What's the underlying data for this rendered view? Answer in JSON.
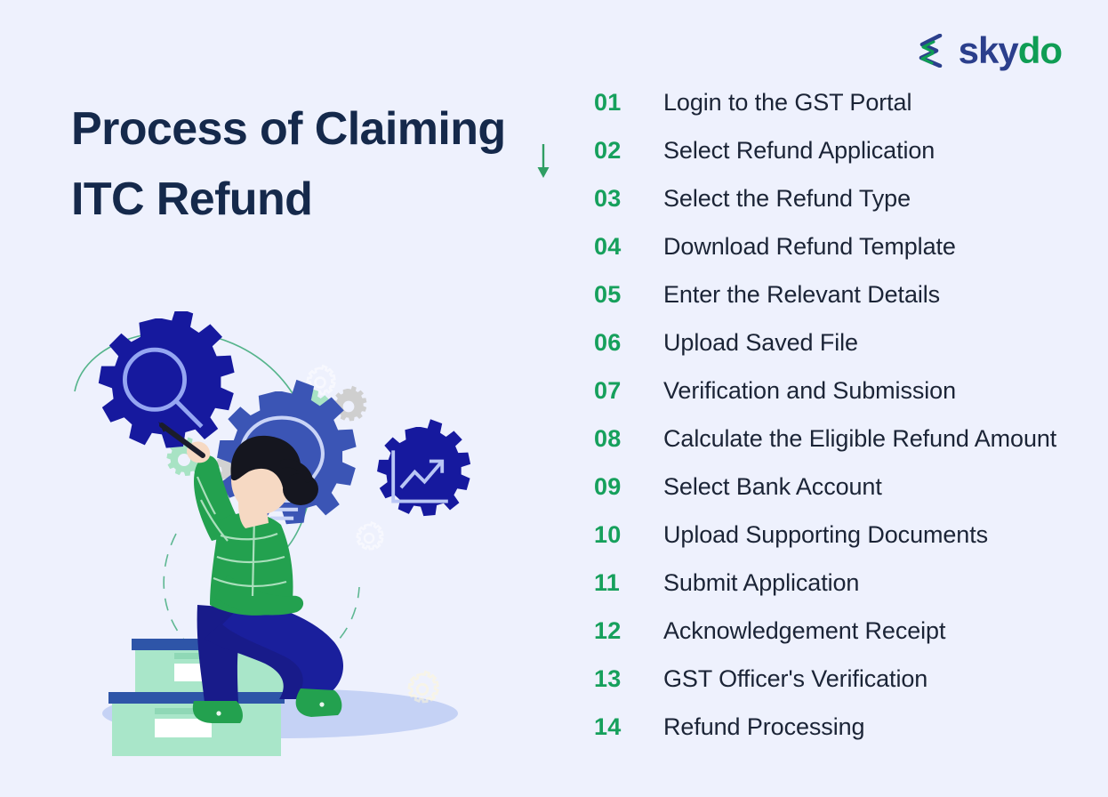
{
  "brand": {
    "logo_icon": "skydo-chevron-s-logo",
    "name_part1": "sky",
    "name_part2": "do",
    "color_blue": "#2b3f8c",
    "color_green": "#0f9d54"
  },
  "header": {
    "title_line1": "Process of Claiming",
    "title_line2": "ITC Refund",
    "title_color": "#15294b",
    "arrow_icon": "arrow-down-icon",
    "arrow_color": "#2f9e63"
  },
  "theme": {
    "background": "#eef1fd",
    "number_green": "#16a05c",
    "label_navy": "#1b2436",
    "gear_dark_navy": "#16199e",
    "gear_royal_blue": "#3b55b5",
    "gear_mint": "#a8e3c4",
    "gear_gray": "#d2d2d2",
    "sweater_green": "#23a14f",
    "pants_navy": "#181b8a",
    "box_mint": "#a9e6c9",
    "box_lid_blue": "#2e55a8",
    "shadow_blue": "#c5d2f5",
    "hair_black": "#15161f",
    "skin": "#f6d9c3"
  },
  "illustration": {
    "name": "person-with-gears-illustration",
    "gear_icons": [
      "magnifier-gear-icon",
      "lightbulb-gear-icon",
      "chart-gear-icon"
    ],
    "props": [
      "pen",
      "stacked-boxes",
      "floor-shadow"
    ]
  },
  "steps": [
    {
      "num": "01",
      "label": "Login to the GST Portal"
    },
    {
      "num": "02",
      "label": "Select Refund Application"
    },
    {
      "num": "03",
      "label": "Select the Refund Type"
    },
    {
      "num": "04",
      "label": "Download Refund Template"
    },
    {
      "num": "05",
      "label": "Enter the Relevant Details"
    },
    {
      "num": "06",
      "label": "Upload Saved File"
    },
    {
      "num": "07",
      "label": "Verification and Submission"
    },
    {
      "num": "08",
      "label": "Calculate the Eligible Refund Amount"
    },
    {
      "num": "09",
      "label": "Select Bank Account"
    },
    {
      "num": "10",
      "label": "Upload Supporting Documents"
    },
    {
      "num": "11",
      "label": "Submit Application"
    },
    {
      "num": "12",
      "label": "Acknowledgement Receipt"
    },
    {
      "num": "13",
      "label": "GST Officer's Verification"
    },
    {
      "num": "14",
      "label": "Refund Processing"
    }
  ]
}
